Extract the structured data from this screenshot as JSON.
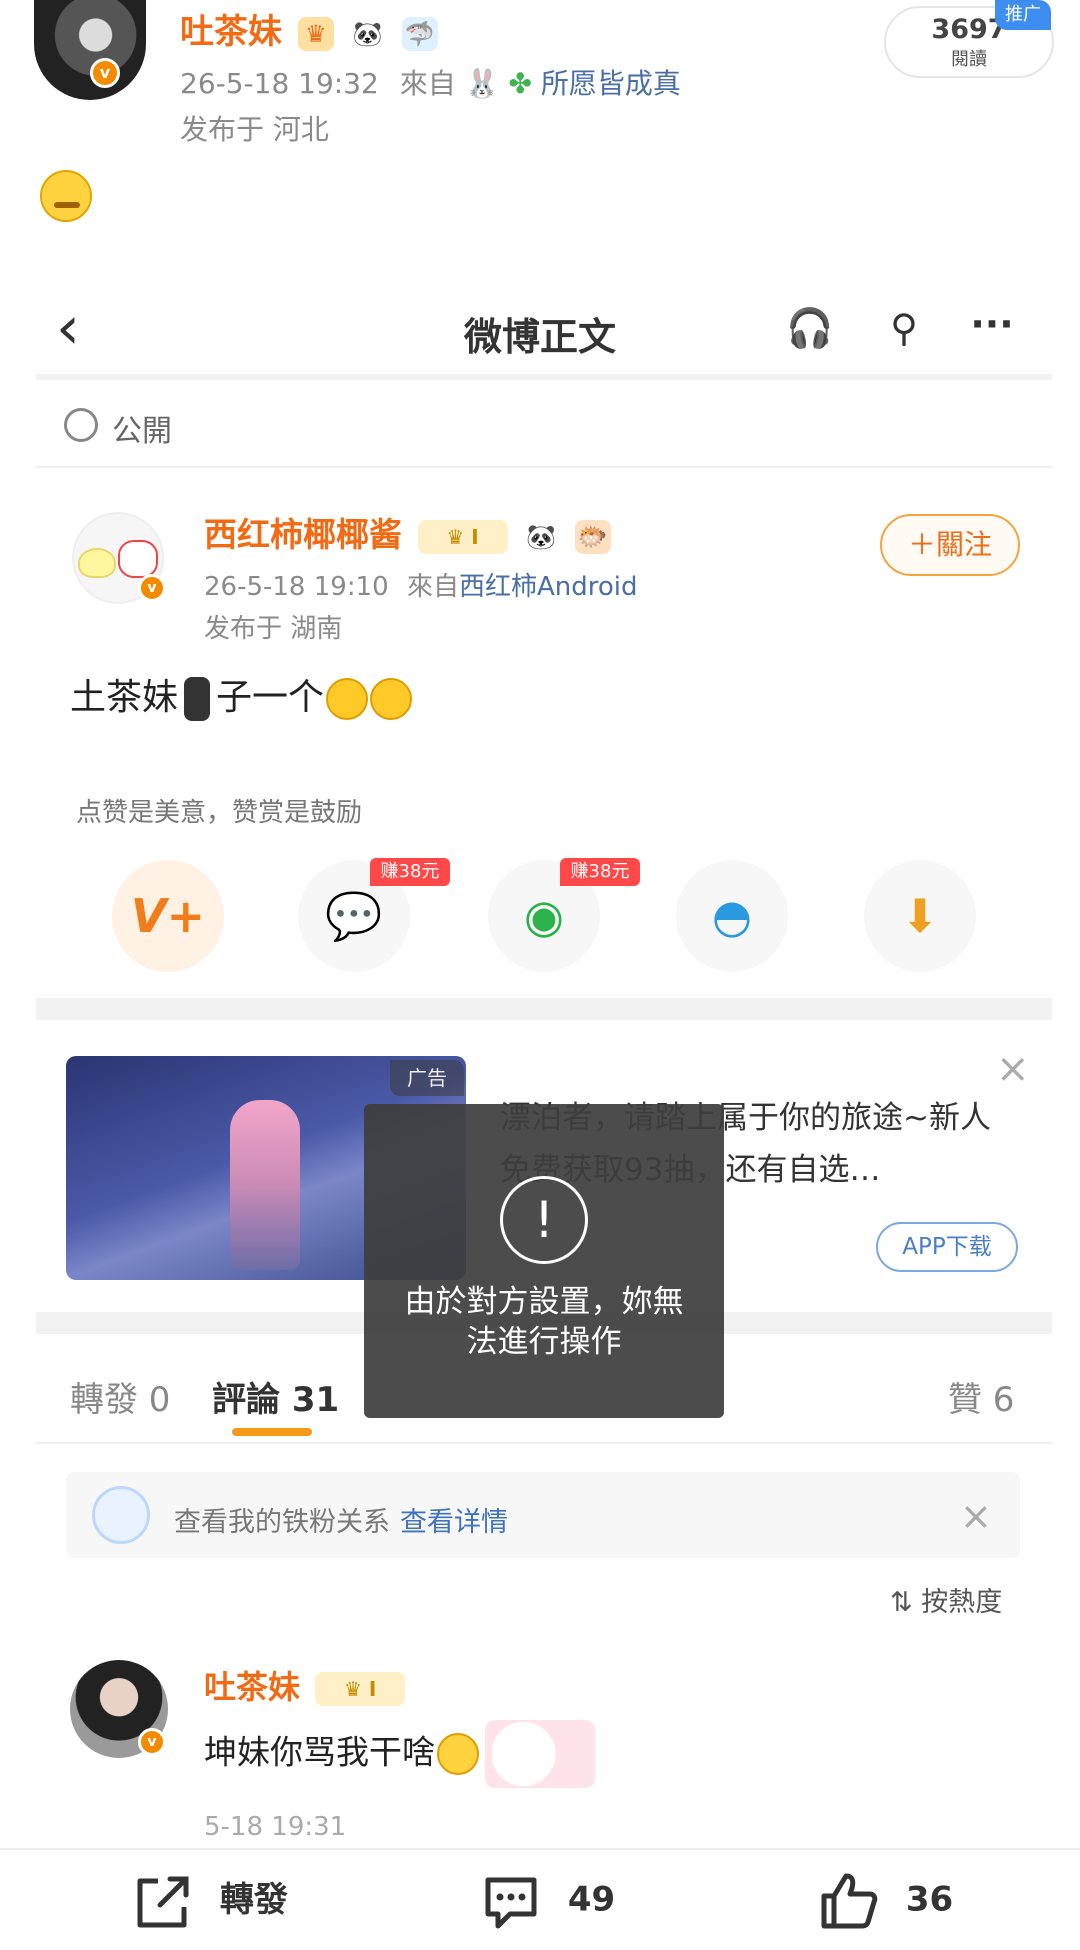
{
  "outer_post": {
    "username": "吐茶妹",
    "timestamp": "26-5-18 19:32",
    "source_prefix": "來自",
    "source_name": "所愿皆成真",
    "location": "发布于 河北",
    "read_count": "3697",
    "read_label": "閱讀",
    "promo_tag": "推广",
    "verified_badge": "v"
  },
  "inner": {
    "nav": {
      "back_icon": "‹",
      "title": "微博正文",
      "listen_icon": "🎧",
      "search_icon": "⚲",
      "more_icon": "···"
    },
    "visibility": "公開",
    "post": {
      "username": "西红柿椰椰酱",
      "timestamp": "26-5-18 19:10",
      "source_prefix": "來自",
      "source_name": "西红柿Android",
      "location": "发布于 湖南",
      "follow_label": "＋關注",
      "text_part1": "土茶妹",
      "text_part2": "子一个"
    },
    "tip": "点赞是美意，赞赏是鼓励",
    "share": {
      "reward_icon": "V+",
      "wechat_icon": "💬",
      "moments_icon": "◉",
      "qq_icon": "◓",
      "save_icon": "⬇",
      "earn_label_1": "赚38元",
      "earn_label_2": "赚38元"
    },
    "ad": {
      "tag": "广告",
      "text": "漂泊者，请踏上属于你的旅途~新人免费获取93抽，还有自选…",
      "button": "APP下载",
      "close": "×"
    },
    "tabs": {
      "repost": "轉發 0",
      "comment": "評論 31",
      "like": "贊 6"
    },
    "fan": {
      "text": "查看我的铁粉关系",
      "link": "查看详情",
      "close": "×"
    },
    "sort": "按熱度",
    "comment": {
      "username": "吐茶妹",
      "text": "坤妹你骂我干啥",
      "time": "5-18 19:31"
    },
    "toast": {
      "icon": "!",
      "line1": "由於對方設置，妳無",
      "line2": "法進行操作"
    }
  },
  "bottom_bar": {
    "repost_label": "轉發",
    "comment_count": "49",
    "like_count": "36"
  },
  "colors": {
    "username_orange": "#f26b14",
    "link_blue": "#4a6fa5",
    "follow_border": "#f7a33d",
    "promo_blue": "#3d8ef0",
    "earn_red": "#ff4848"
  }
}
